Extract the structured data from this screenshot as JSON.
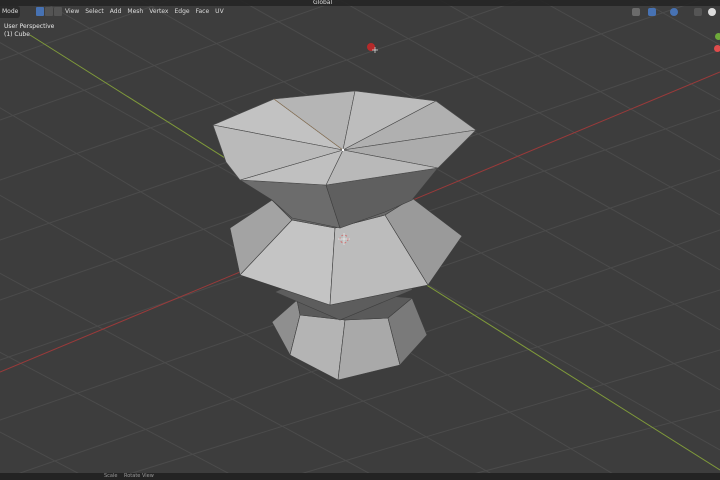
{
  "viewport": {
    "perspective_label": "User Perspective",
    "object_label": "(1) Cube"
  },
  "header": {
    "mode_label": "Mode",
    "menu": [
      "View",
      "Select",
      "Add",
      "Mesh",
      "Vertex",
      "Edge",
      "Face",
      "UV"
    ],
    "orientation_label": "Global"
  },
  "statusbar": {
    "hint": "Rotate View",
    "hint_prefix": "Scale"
  },
  "colors": {
    "background": "#3d3d3d",
    "grid": "#4a4a4a",
    "x_axis": "#9a3a3a",
    "y_axis": "#7f9a3a",
    "mesh_light": "#b9b9b9",
    "mesh_mid": "#9d9d9d",
    "mesh_dark": "#6e6e6e",
    "mesh_darker": "#555555",
    "accent": "#4772b3",
    "gizmo_x": "#e04c4c",
    "gizmo_y": "#6ea93a"
  },
  "icons": [
    "cursor-3d-icon",
    "light-icon",
    "overlay-icon",
    "shading-solid-icon",
    "xray-icon",
    "pivot-icon",
    "snap-icon",
    "proportional-icon"
  ]
}
